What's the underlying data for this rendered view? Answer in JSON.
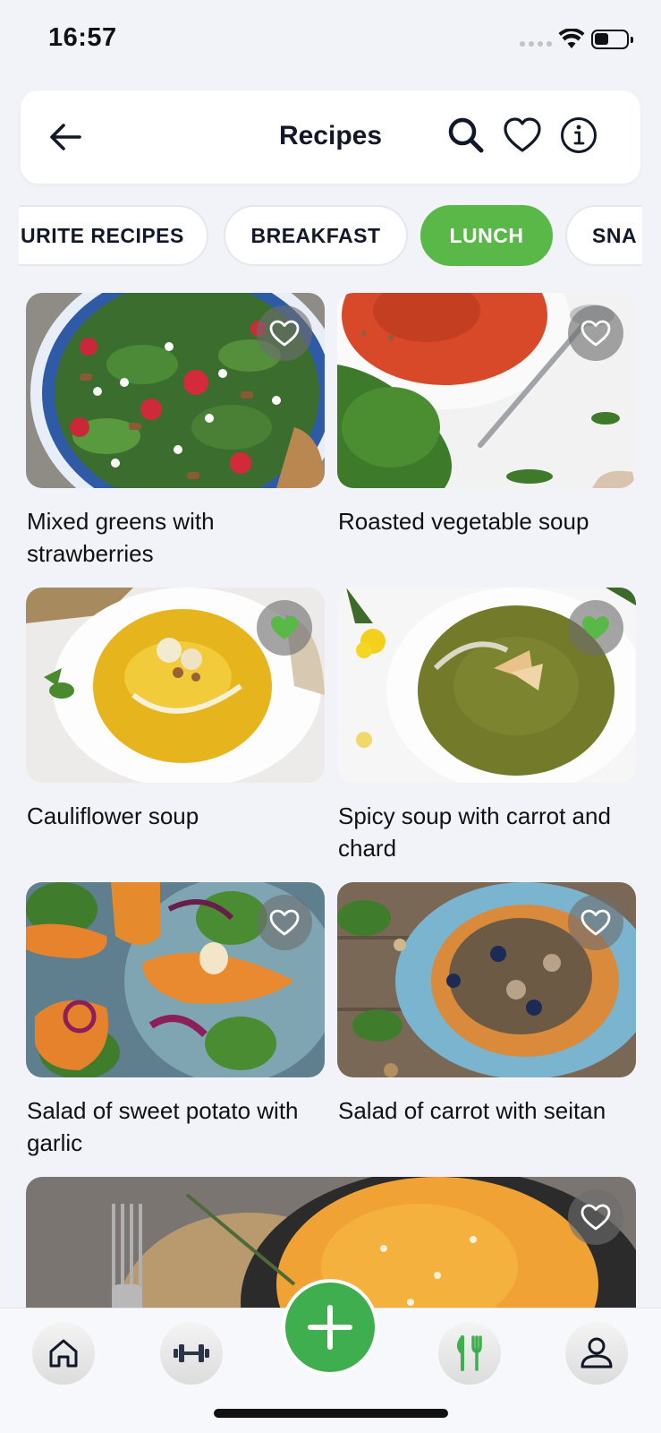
{
  "status_bar": {
    "time": "16:57"
  },
  "header": {
    "title": "Recipes"
  },
  "categories": [
    {
      "label": "URITE RECIPES",
      "active": false
    },
    {
      "label": "BREAKFAST",
      "active": false
    },
    {
      "label": "LUNCH",
      "active": true
    },
    {
      "label": "SNA",
      "active": false
    }
  ],
  "recipes": [
    {
      "title": "Mixed greens with strawberries",
      "favorite": false
    },
    {
      "title": "Roasted vegetable soup",
      "favorite": false
    },
    {
      "title": "Cauliflower soup",
      "favorite": true
    },
    {
      "title": "Spicy soup with carrot and chard",
      "favorite": true
    },
    {
      "title": "Salad of sweet potato with garlic",
      "favorite": false
    },
    {
      "title": "Salad of carrot with seitan",
      "favorite": false
    },
    {
      "title": "",
      "favorite": false
    }
  ],
  "bottom_nav": {
    "items": [
      {
        "icon": "home-icon"
      },
      {
        "icon": "dumbbell-icon"
      },
      {
        "icon": "plus-icon"
      },
      {
        "icon": "fork-knife-icon"
      },
      {
        "icon": "user-icon"
      }
    ]
  },
  "colors": {
    "accent": "#5ab849",
    "background": "#f1f3f8",
    "add_button": "#3fae4e"
  }
}
